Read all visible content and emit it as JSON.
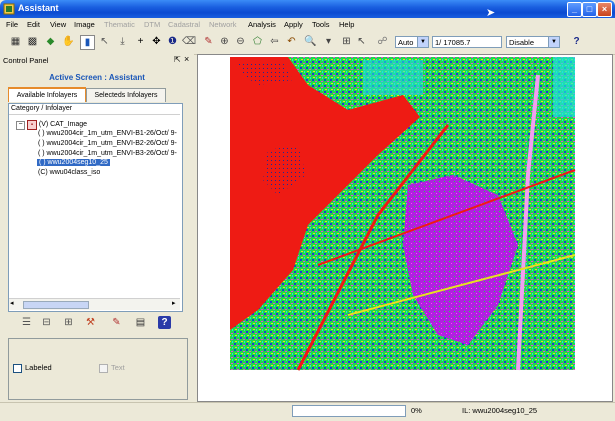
{
  "window": {
    "title": "Assistant"
  },
  "menu": [
    "File",
    "Edit",
    "View",
    "Image",
    "Thematic",
    "DTM",
    "Cadastral",
    "Network",
    "Analysis",
    "Apply",
    "Tools",
    "Help"
  ],
  "menu_disabled": [
    "Thematic",
    "DTM",
    "Cadastral",
    "Network"
  ],
  "toolbar": {
    "mode_select": "Auto",
    "scale_value": "1/ 17085.7",
    "state_select": "Disable"
  },
  "control_panel": {
    "title": "Control Panel",
    "active_screen": "Active Screen : Assistant",
    "tabs": [
      "Available Infolayers",
      "Selecteds Infolayers"
    ],
    "tree_header": "Category / Infolayer",
    "tree": [
      {
        "label": "(V) CAT_Image"
      },
      {
        "label": "( ) wwu2004cir_1m_utm_ENVI-B1-26/Oct/ 9-"
      },
      {
        "label": "( ) wwu2004cir_1m_utm_ENVI-B2-26/Oct/ 9-"
      },
      {
        "label": "( ) wwu2004cir_1m_utm_ENVI-B3-26/Oct/ 9-"
      },
      {
        "label": "( ) wwu2004seg10_25"
      },
      {
        "label": "(C) wwu04class_iso"
      }
    ],
    "options": {
      "labeled": "Labeled",
      "text": "Text"
    }
  },
  "status": {
    "progress_text": "0%",
    "layer_info": "IL: wwu2004seg10_25"
  },
  "colors": {
    "title_bar": "#0b4bd1",
    "accent": "#1a56b8",
    "selection": "#316ac5"
  }
}
